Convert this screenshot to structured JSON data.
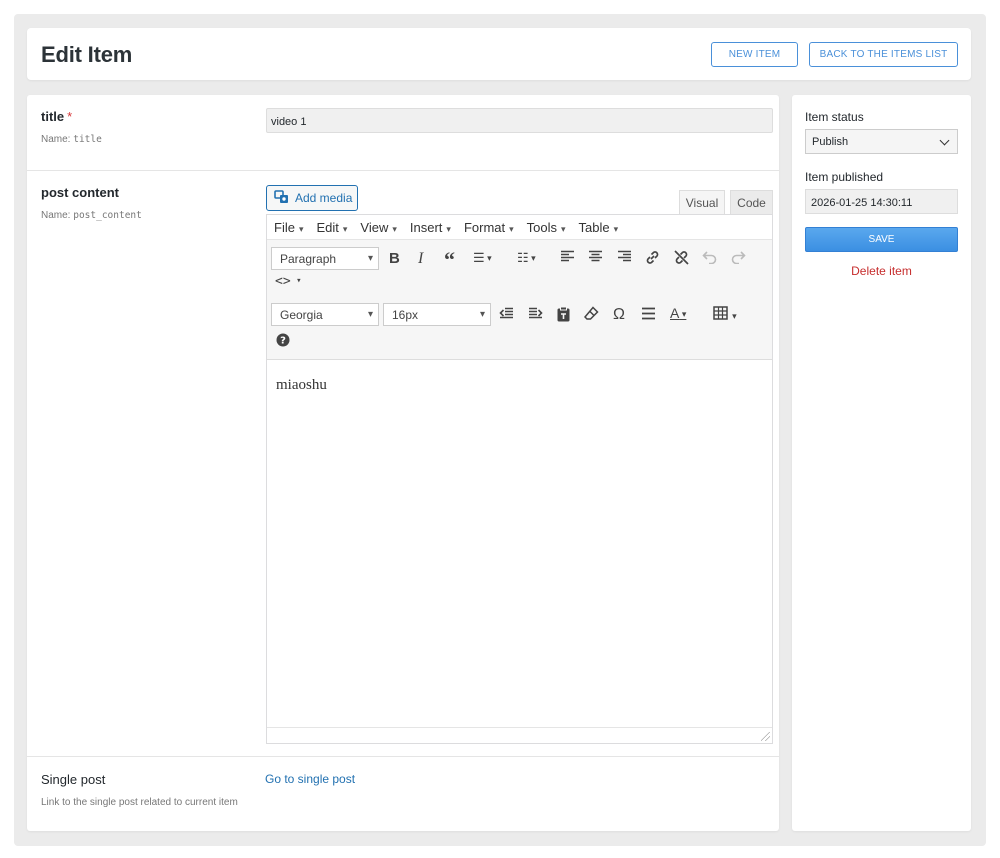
{
  "header": {
    "title": "Edit Item",
    "new_item_label": "NEW ITEM",
    "back_label": "BACK TO THE ITEMS LIST"
  },
  "fields": {
    "title": {
      "label": "title",
      "required_mark": "*",
      "name_prefix": "Name:",
      "name": "title",
      "value": "video 1"
    },
    "post_content": {
      "label": "post content",
      "name_prefix": "Name:",
      "name": "post_content",
      "add_media_label": "Add media",
      "tab_visual": "Visual",
      "tab_code": "Code",
      "menu": [
        "File",
        "Edit",
        "View",
        "Insert",
        "Format",
        "Tools",
        "Table"
      ],
      "format_select": "Paragraph",
      "font_select": "Georgia",
      "size_select": "16px",
      "content": "miaoshu"
    },
    "single_post": {
      "label": "Single post",
      "description": "Link to the single post related to current item",
      "link_text": "Go to single post"
    }
  },
  "sidebar": {
    "status_label": "Item status",
    "status_value": "Publish",
    "published_label": "Item published",
    "published_value": "2026-01-25 14:30:11",
    "save_label": "SAVE",
    "delete_label": "Delete item"
  },
  "colors": {
    "accent": "#2271b1",
    "save_button": "#3b8fe2",
    "delete": "#c62d2d",
    "required": "#d63638"
  },
  "icons": [
    "add-media-icon",
    "bold-icon",
    "italic-icon",
    "blockquote-icon",
    "bullet-list-icon",
    "numbered-list-icon",
    "align-left-icon",
    "align-center-icon",
    "align-right-icon",
    "link-icon",
    "unlink-icon",
    "undo-icon",
    "redo-icon",
    "source-code-icon",
    "outdent-icon",
    "indent-icon",
    "paste-text-icon",
    "clear-format-icon",
    "special-char-icon",
    "horizontal-line-icon",
    "text-color-icon",
    "table-icon",
    "help-icon",
    "resize-grip-icon"
  ]
}
